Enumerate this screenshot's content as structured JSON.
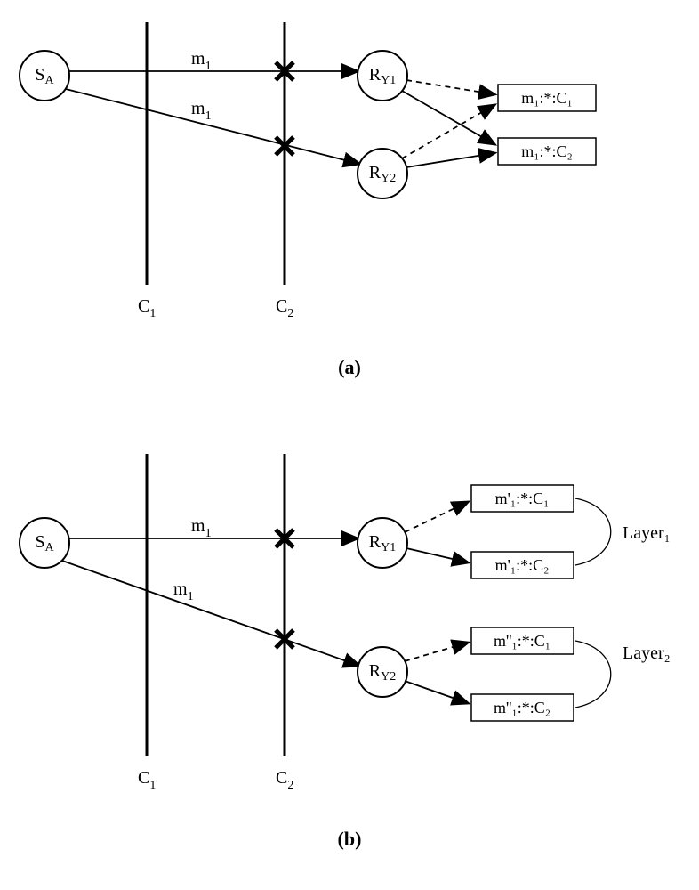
{
  "source": "S",
  "source_sub": "A",
  "msg": "m",
  "msg_sub": "1",
  "col1": "C",
  "col1_sub": "1",
  "col2": "C",
  "col2_sub": "2",
  "r1": "R",
  "r1_sub": "Y1",
  "r2": "R",
  "r2_sub": "Y2",
  "box_a1": "m₁:*:C₁",
  "box_a2": "m₁:*:C₂",
  "box_b1": "m'₁:*:C₁",
  "box_b2": "m'₁:*:C₂",
  "box_b3": "m''₁:*:C₁",
  "box_b4": "m''₁:*:C₂",
  "layer1": "Layer₁",
  "layer2": "Layer₂",
  "cap_a": "(a)",
  "cap_b": "(b)"
}
